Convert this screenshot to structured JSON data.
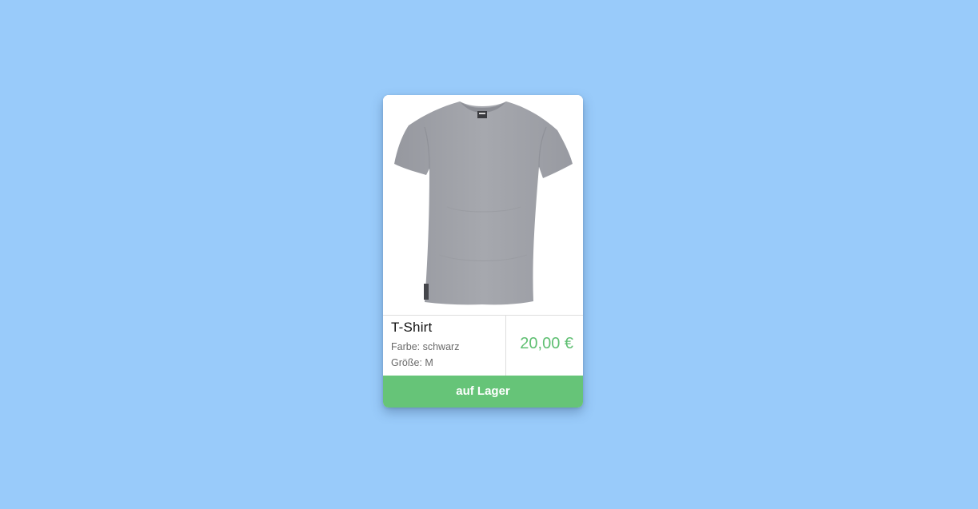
{
  "colors": {
    "background": "#99cbfa",
    "card": "#ffffff",
    "accent": "#66c478",
    "price": "#5fbf72",
    "shirt": "#a3a5ab"
  },
  "product": {
    "image_icon": "tshirt-icon",
    "name": "T-Shirt",
    "color_line": "Farbe: schwarz",
    "size_line": "Größe: M",
    "price": "20,00 €",
    "stock_label": "auf Lager"
  }
}
